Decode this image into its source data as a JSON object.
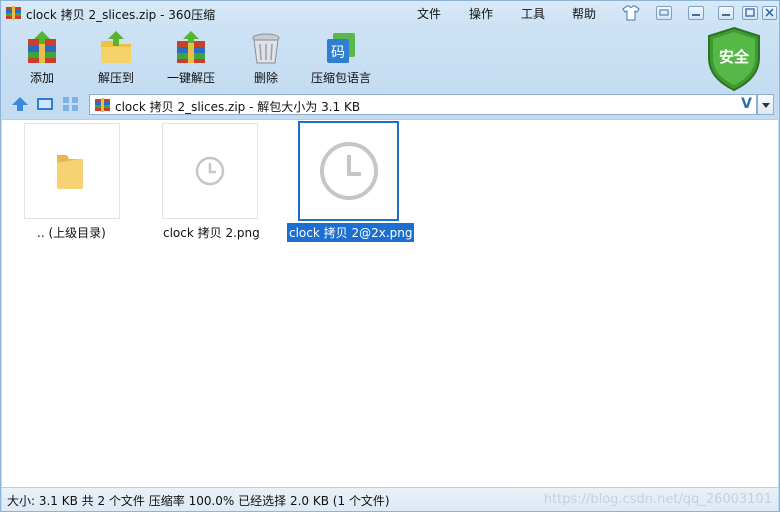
{
  "window": {
    "title": "clock 拷贝 2_slices.zip - 360压缩",
    "menu": [
      "文件",
      "操作",
      "工具",
      "帮助"
    ]
  },
  "toolbar": {
    "add_label": "添加",
    "extract_to_label": "解压到",
    "one_click_label": "一键解压",
    "delete_label": "删除",
    "encoding_label": "压缩包语言",
    "encoding_glyph": "码",
    "security_label": "安全"
  },
  "address": {
    "path": "clock 拷贝 2_slices.zip - 解包大小为 3.1 KB",
    "verify_mark": "V"
  },
  "files": [
    {
      "label": ".. (上级目录)",
      "type": "folder"
    },
    {
      "label": "clock 拷贝 2.png",
      "type": "image"
    },
    {
      "label": "clock 拷贝 2@2x.png",
      "type": "image",
      "selected": true
    }
  ],
  "status": {
    "text": "大小: 3.1 KB 共 2 个文件 压缩率 100.0% 已经选择 2.0 KB (1 个文件)",
    "watermark": "https://blog.csdn.net/qq_26003101"
  },
  "colors": {
    "accent": "#1c6fd0",
    "shield": "#3f9a32"
  }
}
